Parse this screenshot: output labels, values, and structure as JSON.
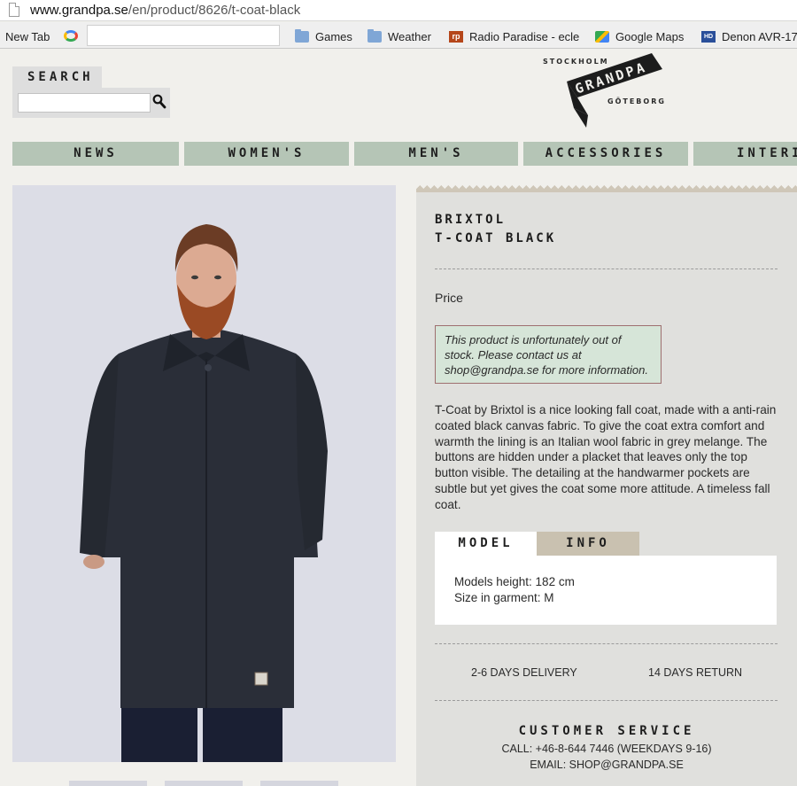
{
  "browser": {
    "url_host": "www.grandpa.se",
    "url_path": "/en/product/8626/t-coat-black",
    "bookmarks": [
      {
        "label": "New Tab",
        "icon": "new-tab"
      },
      {
        "label": "",
        "icon": "google-icon"
      },
      {
        "label": "Games",
        "icon": "folder-icon"
      },
      {
        "label": "Weather",
        "icon": "folder-icon"
      },
      {
        "label": "Radio Paradise - ecle",
        "icon": "radio-paradise-icon"
      },
      {
        "label": "Google Maps",
        "icon": "google-maps-icon"
      },
      {
        "label": "Denon AVR-17",
        "icon": "denon-icon"
      }
    ]
  },
  "header": {
    "search_label": "SEARCH",
    "search_value": "",
    "logo": {
      "top_text": "STOCKHOLM",
      "brand": "GRANDPA",
      "bottom_text": "GÖTEBORG"
    }
  },
  "nav": [
    "NEWS",
    "WOMEN'S",
    "MEN'S",
    "ACCESSORIES",
    "INTERIO"
  ],
  "product": {
    "brand": "BRIXTOL",
    "name": "T-COAT BLACK",
    "price_label": "Price",
    "stock_notice": "This product is unfortunately out of stock. Please contact us at shop@grandpa.se for more information.",
    "description": "T-Coat by Brixtol is a nice looking fall coat, made with a anti-rain coated black canvas fabric. To give the coat extra comfort and warmth the lining is an Italian wool fabric in grey melange. The buttons are hidden under a placket that leaves only the top button visible. The detailing at the handwarmer pockets are subtle but yet gives the coat some more attitude. A timeless fall coat.",
    "tabs": [
      "MODEL",
      "INFO"
    ],
    "model_height": "Models height: 182 cm",
    "garment_size": "Size in garment: M",
    "delivery": "2-6 DAYS DELIVERY",
    "returns": "14 DAYS RETURN"
  },
  "customer_service": {
    "title": "CUSTOMER SERVICE",
    "call": "CALL: +46-8-644 7446 (WEEKDAYS 9-16)",
    "email": "EMAIL: SHOP@GRANDPA.SE"
  },
  "colors": {
    "nav_green": "#b5c5b6",
    "panel_grey": "#e0e0dd",
    "stock_green": "#d6e5d8",
    "info_tab": "#c9c1b0"
  }
}
